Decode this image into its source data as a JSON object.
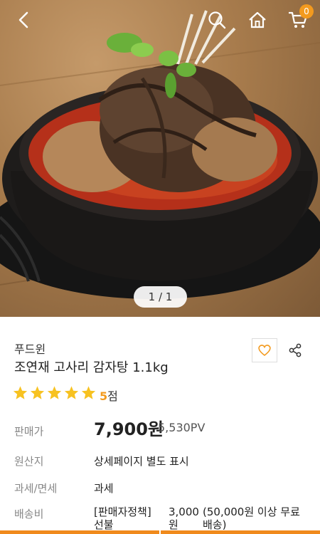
{
  "header": {
    "cart_count": "0",
    "icons": [
      "chevron-left-icon",
      "search-icon",
      "home-icon",
      "cart-icon"
    ]
  },
  "hero": {
    "page_indicator": "1 / 1"
  },
  "product": {
    "brand": "푸드윈",
    "name": "조연재 고사리 감자탕 1.1kg",
    "rating": {
      "stars": 5,
      "score": "5",
      "unit": "점"
    }
  },
  "details": {
    "price_label": "판매가",
    "price": "7,900원",
    "pv": "5,530PV",
    "origin_label": "원산지",
    "origin_value": "상세페이지 별도 표시",
    "tax_label": "과세/면세",
    "tax_value": "과세",
    "shipping_label": "배송비",
    "shipping_policy": "[판매자정책] 선불",
    "shipping_fee": "3,000원",
    "shipping_note": "(50,000원 이상 무료배송)"
  },
  "colors": {
    "accent": "#f39a1e",
    "bottom_bar": "#f08a1c",
    "star": "#f7c221"
  }
}
